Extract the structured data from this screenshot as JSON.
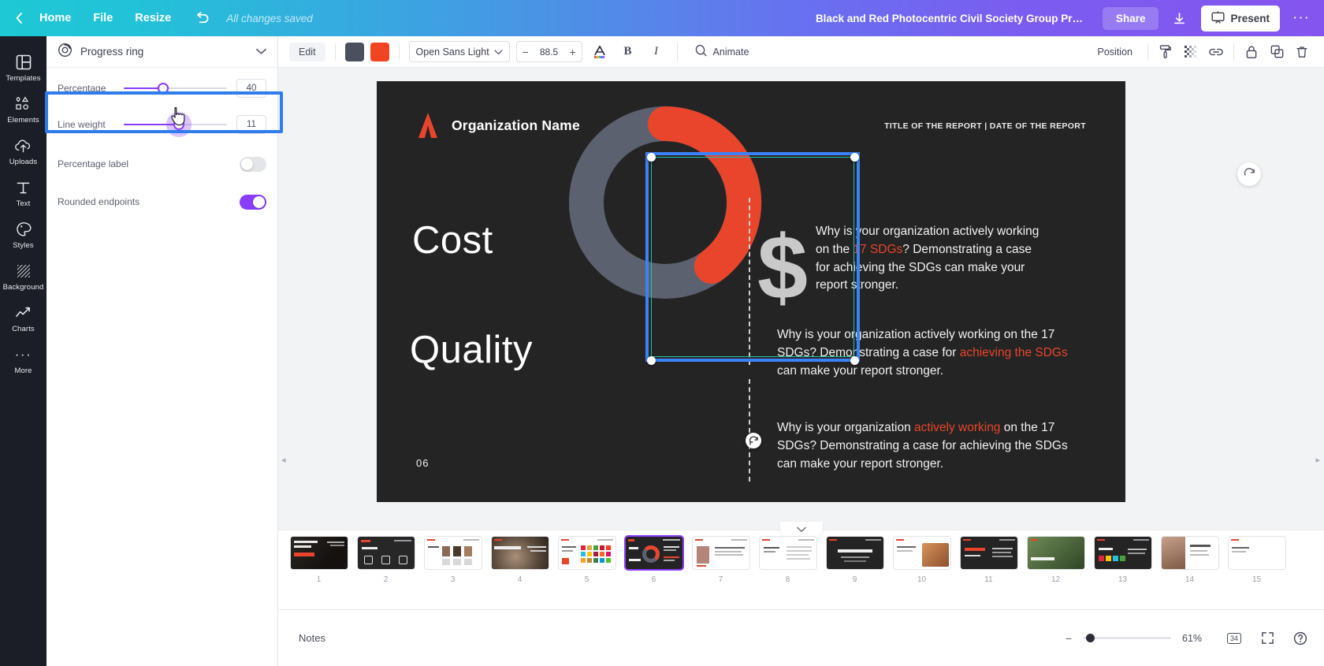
{
  "topbar": {
    "back_icon": "chevron-left-icon",
    "home_label": "Home",
    "file_label": "File",
    "resize_label": "Resize",
    "undo_icon": "undo-icon",
    "save_status": "All changes saved",
    "doc_title": "Black and Red Photocentric Civil Society Group Progress Re...",
    "share_label": "Share",
    "download_icon": "download-icon",
    "present_icon": "present-icon",
    "present_label": "Present",
    "more_icon": "more-horizontal-icon",
    "gradient_from": "#1ec8d4",
    "gradient_to": "#8455ef"
  },
  "rail": {
    "items": [
      {
        "label": "Templates",
        "icon": "templates-icon"
      },
      {
        "label": "Elements",
        "icon": "elements-icon"
      },
      {
        "label": "Uploads",
        "icon": "uploads-icon"
      },
      {
        "label": "Text",
        "icon": "text-icon"
      },
      {
        "label": "Styles",
        "icon": "styles-icon"
      },
      {
        "label": "Background",
        "icon": "background-icon"
      },
      {
        "label": "Charts",
        "icon": "charts-icon"
      },
      {
        "label": "More",
        "icon": "more-dots-icon"
      }
    ]
  },
  "panel": {
    "title": "Progress ring",
    "title_icon": "progress-ring-icon",
    "collapse_icon": "chevron-down-icon",
    "percentage": {
      "label": "Percentage",
      "value": "40",
      "fill_pct": 40
    },
    "line_weight": {
      "label": "Line weight",
      "value": "11",
      "fill_pct": 52,
      "highlighted": true
    },
    "percentage_label": {
      "label": "Percentage label",
      "state": "off"
    },
    "rounded_endpoints": {
      "label": "Rounded endpoints",
      "state": "on"
    },
    "accent_color": "#8b3dff",
    "highlight_color": "#2f7ced"
  },
  "toolbar": {
    "edit_label": "Edit",
    "color_swatch_1": "#4a505e",
    "color_swatch_2": "#f04423",
    "font_name": "Open Sans Light",
    "font_caret_icon": "chevron-down-icon",
    "size_minus": "−",
    "font_size": "88.5",
    "size_plus": "+",
    "text_color_icon": "text-color-icon",
    "bold_label": "B",
    "italic_label": "I",
    "animate_icon": "animate-icon",
    "animate_label": "Animate",
    "position_label": "Position",
    "copy_style_icon": "paint-roller-icon",
    "transparency_icon": "transparency-icon",
    "link_icon": "link-icon",
    "lock_icon": "lock-icon",
    "duplicate_icon": "duplicate-icon",
    "delete_icon": "trash-icon"
  },
  "slide": {
    "background": "#242424",
    "logo_icon": "organization-logo-icon",
    "org_name": "Organization Name",
    "report_meta": "TITLE OF THE REPORT | DATE OF THE REPORT",
    "label_cost": "Cost",
    "label_quality": "Quality",
    "page_number": "06",
    "dollar_icon": "dollar-sign-icon",
    "accent_red": "#e8452c",
    "ring": {
      "track_color": "#5c6170",
      "progress_color": "#e8452c",
      "percent": 40,
      "line_weight": 11,
      "rounded_endpoints": true
    },
    "text_blocks": [
      {
        "parts": [
          {
            "text": "Why is your organization actively working on the ",
            "highlight": false
          },
          {
            "text": "17 SDGs",
            "highlight": true
          },
          {
            "text": "? Demonstrating a case for achieving the SDGs can make your report stronger.",
            "highlight": false
          }
        ]
      },
      {
        "parts": [
          {
            "text": "Why is your organization actively working on the 17 SDGs? Demonstrating a case for ",
            "highlight": false
          },
          {
            "text": "achieving the SDGs",
            "highlight": true
          },
          {
            "text": " can make your report stronger.",
            "highlight": false
          }
        ]
      },
      {
        "parts": [
          {
            "text": "Why is your organization ",
            "highlight": false
          },
          {
            "text": "actively working",
            "highlight": true
          },
          {
            "text": " on the 17 SDGs? Demonstrating a case for achieving the SDGs can make your report stronger.",
            "highlight": false
          }
        ]
      }
    ],
    "selection": {
      "outer_color": "#3b82f6",
      "inner_color": "#25bfa8",
      "rotate_icon": "rotate-handle-icon"
    }
  },
  "strip": {
    "collapse_icon": "chevron-down-icon",
    "selected_page": 6,
    "pages": [
      {
        "number": "1",
        "style": "dark-photo"
      },
      {
        "number": "2",
        "style": "dark-icons"
      },
      {
        "number": "3",
        "style": "light-faces"
      },
      {
        "number": "4",
        "style": "photo-bear"
      },
      {
        "number": "5",
        "style": "light-grid"
      },
      {
        "number": "6",
        "style": "dark-ring"
      },
      {
        "number": "7",
        "style": "light-portrait"
      },
      {
        "number": "8",
        "style": "light-text"
      },
      {
        "number": "9",
        "style": "dark-text"
      },
      {
        "number": "10",
        "style": "photo-orange"
      },
      {
        "number": "11",
        "style": "dark-red"
      },
      {
        "number": "12",
        "style": "photo-green"
      },
      {
        "number": "13",
        "style": "dark-colorful"
      },
      {
        "number": "14",
        "style": "photo-light"
      },
      {
        "number": "15",
        "style": "light-partial"
      }
    ]
  },
  "bottombar": {
    "notes_label": "Notes",
    "zoom_minus": "−",
    "zoom_value": "61%",
    "zoom_fill_pct": 6,
    "page_count": "34",
    "fullscreen_icon": "fullscreen-icon",
    "help_icon": "help-icon"
  }
}
